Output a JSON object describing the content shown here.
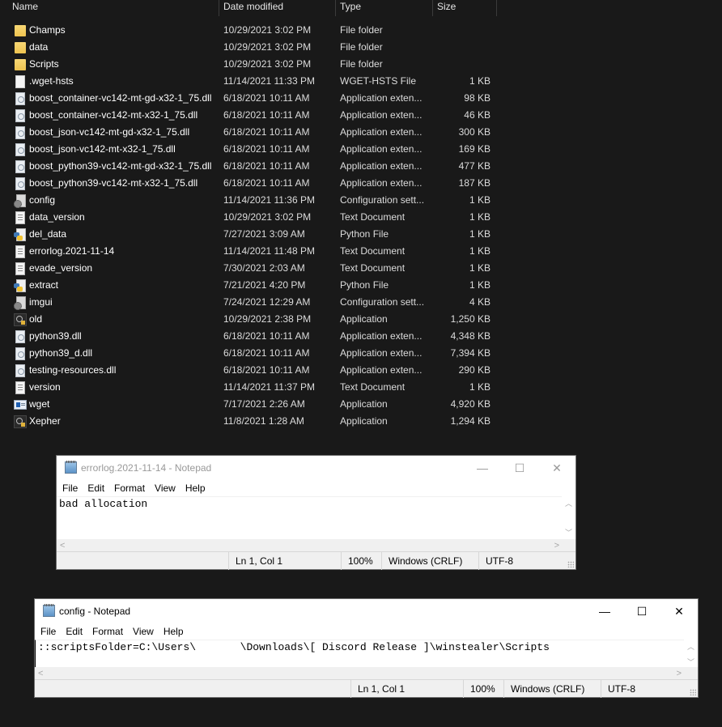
{
  "explorer": {
    "columns": {
      "name": "Name",
      "date": "Date modified",
      "type": "Type",
      "size": "Size"
    },
    "files": [
      {
        "icon": "folder-icon",
        "kind": "folder",
        "name": "Champs",
        "date": "10/29/2021 3:02 PM",
        "type": "File folder",
        "size": ""
      },
      {
        "icon": "folder-icon",
        "kind": "folder",
        "name": "data",
        "date": "10/29/2021 3:02 PM",
        "type": "File folder",
        "size": ""
      },
      {
        "icon": "folder-icon",
        "kind": "folder",
        "name": "Scripts",
        "date": "10/29/2021 3:02 PM",
        "type": "File folder",
        "size": ""
      },
      {
        "icon": "blank-file-icon",
        "kind": "file",
        "name": ".wget-hsts",
        "date": "11/14/2021 11:33 PM",
        "type": "WGET-HSTS File",
        "size": "1 KB"
      },
      {
        "icon": "dll-file-icon",
        "kind": "dll",
        "name": "boost_container-vc142-mt-gd-x32-1_75.dll",
        "date": "6/18/2021 10:11 AM",
        "type": "Application exten...",
        "size": "98 KB"
      },
      {
        "icon": "dll-file-icon",
        "kind": "dll",
        "name": "boost_container-vc142-mt-x32-1_75.dll",
        "date": "6/18/2021 10:11 AM",
        "type": "Application exten...",
        "size": "46 KB"
      },
      {
        "icon": "dll-file-icon",
        "kind": "dll",
        "name": "boost_json-vc142-mt-gd-x32-1_75.dll",
        "date": "6/18/2021 10:11 AM",
        "type": "Application exten...",
        "size": "300 KB"
      },
      {
        "icon": "dll-file-icon",
        "kind": "dll",
        "name": "boost_json-vc142-mt-x32-1_75.dll",
        "date": "6/18/2021 10:11 AM",
        "type": "Application exten...",
        "size": "169 KB"
      },
      {
        "icon": "dll-file-icon",
        "kind": "dll",
        "name": "boost_python39-vc142-mt-gd-x32-1_75.dll",
        "date": "6/18/2021 10:11 AM",
        "type": "Application exten...",
        "size": "477 KB"
      },
      {
        "icon": "dll-file-icon",
        "kind": "dll",
        "name": "boost_python39-vc142-mt-x32-1_75.dll",
        "date": "6/18/2021 10:11 AM",
        "type": "Application exten...",
        "size": "187 KB"
      },
      {
        "icon": "config-file-icon",
        "kind": "cfg",
        "name": "config",
        "date": "11/14/2021 11:36 PM",
        "type": "Configuration sett...",
        "size": "1 KB"
      },
      {
        "icon": "text-file-icon",
        "kind": "txt",
        "name": "data_version",
        "date": "10/29/2021 3:02 PM",
        "type": "Text Document",
        "size": "1 KB"
      },
      {
        "icon": "python-file-icon",
        "kind": "py",
        "name": "del_data",
        "date": "7/27/2021 3:09 AM",
        "type": "Python File",
        "size": "1 KB"
      },
      {
        "icon": "text-file-icon",
        "kind": "txt",
        "name": "errorlog.2021-11-14",
        "date": "11/14/2021 11:48 PM",
        "type": "Text Document",
        "size": "1 KB"
      },
      {
        "icon": "text-file-icon",
        "kind": "txt",
        "name": "evade_version",
        "date": "7/30/2021 2:03 AM",
        "type": "Text Document",
        "size": "1 KB"
      },
      {
        "icon": "python-file-icon",
        "kind": "py",
        "name": "extract",
        "date": "7/21/2021 4:20 PM",
        "type": "Python File",
        "size": "1 KB"
      },
      {
        "icon": "config-file-icon",
        "kind": "cfg",
        "name": "imgui",
        "date": "7/24/2021 12:29 AM",
        "type": "Configuration sett...",
        "size": "4 KB"
      },
      {
        "icon": "application-icon",
        "kind": "app",
        "name": "old",
        "date": "10/29/2021 2:38 PM",
        "type": "Application",
        "size": "1,250 KB"
      },
      {
        "icon": "dll-file-icon",
        "kind": "dll",
        "name": "python39.dll",
        "date": "6/18/2021 10:11 AM",
        "type": "Application exten...",
        "size": "4,348 KB"
      },
      {
        "icon": "dll-file-icon",
        "kind": "dll",
        "name": "python39_d.dll",
        "date": "6/18/2021 10:11 AM",
        "type": "Application exten...",
        "size": "7,394 KB"
      },
      {
        "icon": "dll-file-icon",
        "kind": "dll",
        "name": "testing-resources.dll",
        "date": "6/18/2021 10:11 AM",
        "type": "Application exten...",
        "size": "290 KB"
      },
      {
        "icon": "text-file-icon",
        "kind": "txt",
        "name": "version",
        "date": "11/14/2021 11:37 PM",
        "type": "Text Document",
        "size": "1 KB"
      },
      {
        "icon": "wget-app-icon",
        "kind": "wget",
        "name": "wget",
        "date": "7/17/2021 2:26 AM",
        "type": "Application",
        "size": "4,920 KB"
      },
      {
        "icon": "application-icon",
        "kind": "app",
        "name": "Xepher",
        "date": "11/8/2021 1:28 AM",
        "type": "Application",
        "size": "1,294 KB"
      }
    ]
  },
  "notepad_errorlog": {
    "title": "errorlog.2021-11-14 - Notepad",
    "menu": [
      "File",
      "Edit",
      "Format",
      "View",
      "Help"
    ],
    "content": "bad allocation",
    "status": {
      "position": "Ln 1, Col 1",
      "zoom": "100%",
      "line_ending": "Windows (CRLF)",
      "encoding": "UTF-8"
    },
    "buttons": {
      "minimize": "—",
      "maximize": "☐",
      "close": "✕"
    }
  },
  "notepad_config": {
    "title": "config - Notepad",
    "menu": [
      "File",
      "Edit",
      "Format",
      "View",
      "Help"
    ],
    "content": "::scriptsFolder=C:\\Users\\       \\Downloads\\[ Discord Release ]\\winstealer\\Scripts",
    "status": {
      "position": "Ln 1, Col 1",
      "zoom": "100%",
      "line_ending": "Windows (CRLF)",
      "encoding": "UTF-8"
    },
    "buttons": {
      "minimize": "—",
      "maximize": "☐",
      "close": "✕"
    }
  }
}
